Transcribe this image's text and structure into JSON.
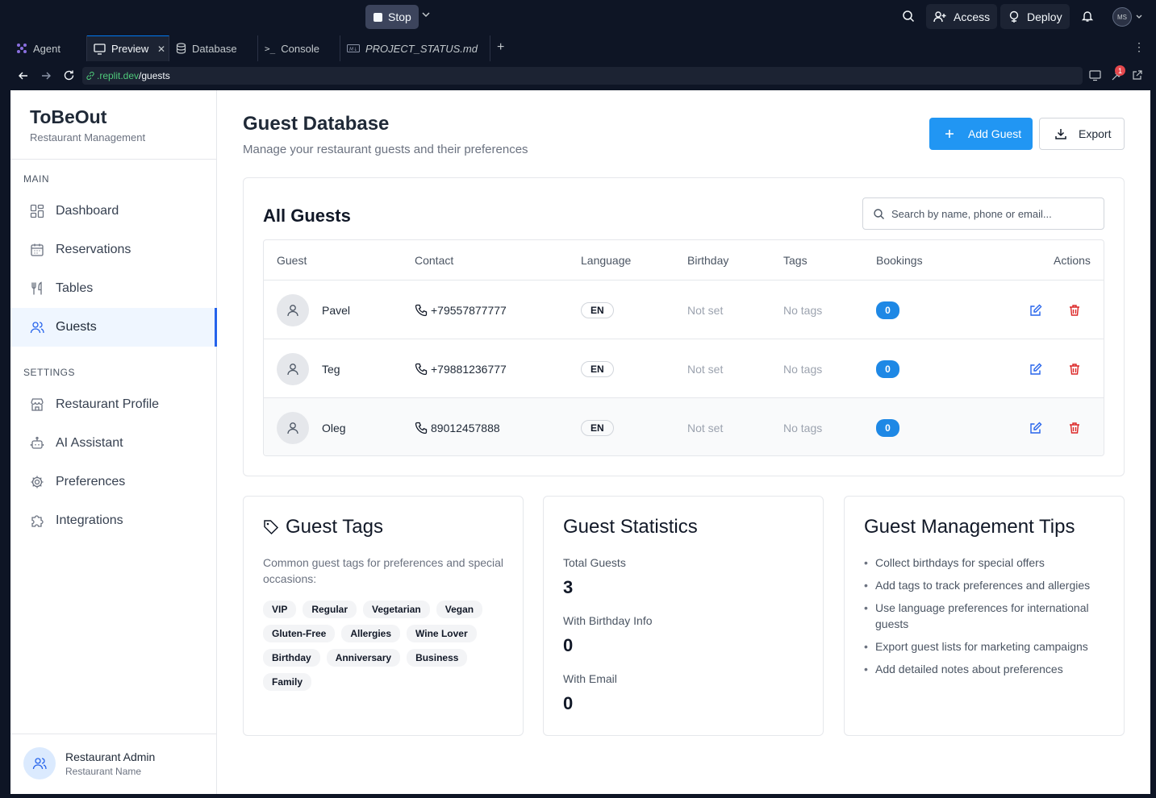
{
  "topbar": {
    "stop_label": "Stop",
    "access_label": "Access",
    "deploy_label": "Deploy",
    "avatar_initials": "MS"
  },
  "tabs": [
    {
      "label": "Agent"
    },
    {
      "label": "Preview"
    },
    {
      "label": "Database"
    },
    {
      "label": "Console"
    },
    {
      "label": "PROJECT_STATUS.md"
    }
  ],
  "address": {
    "host": ".replit.dev",
    "path": "/guests",
    "notification_count": "1"
  },
  "sidebar": {
    "brand": "ToBeOut",
    "brand_sub": "Restaurant Management",
    "main_heading": "MAIN",
    "main_items": [
      {
        "label": "Dashboard",
        "icon": "dashboard-icon"
      },
      {
        "label": "Reservations",
        "icon": "calendar-icon"
      },
      {
        "label": "Tables",
        "icon": "utensils-icon"
      },
      {
        "label": "Guests",
        "icon": "users-icon",
        "active": true
      }
    ],
    "settings_heading": "SETTINGS",
    "settings_items": [
      {
        "label": "Restaurant Profile",
        "icon": "store-icon"
      },
      {
        "label": "AI Assistant",
        "icon": "bot-icon"
      },
      {
        "label": "Preferences",
        "icon": "gear-icon"
      },
      {
        "label": "Integrations",
        "icon": "puzzle-icon"
      }
    ],
    "user_name": "Restaurant Admin",
    "user_sub": "Restaurant Name"
  },
  "page": {
    "title": "Guest Database",
    "subtitle": "Manage your restaurant guests and their preferences",
    "add_label": "Add Guest",
    "export_label": "Export"
  },
  "guests": {
    "title": "All Guests",
    "search_placeholder": "Search by name, phone or email...",
    "columns": [
      "Guest",
      "Contact",
      "Language",
      "Birthday",
      "Tags",
      "Bookings",
      "Actions"
    ],
    "rows": [
      {
        "name": "Pavel",
        "phone": "+79557877777",
        "language": "EN",
        "birthday": "Not set",
        "tags": "No tags",
        "bookings": "0"
      },
      {
        "name": "Teg",
        "phone": "+79881236777",
        "language": "EN",
        "birthday": "Not set",
        "tags": "No tags",
        "bookings": "0"
      },
      {
        "name": "Oleg",
        "phone": "89012457888",
        "language": "EN",
        "birthday": "Not set",
        "tags": "No tags",
        "bookings": "0"
      }
    ]
  },
  "guest_tags": {
    "title": "Guest Tags",
    "description": "Common guest tags for preferences and special occasions:",
    "tags": [
      "VIP",
      "Regular",
      "Vegetarian",
      "Vegan",
      "Gluten-Free",
      "Allergies",
      "Wine Lover",
      "Birthday",
      "Anniversary",
      "Business",
      "Family"
    ]
  },
  "stats": {
    "title": "Guest Statistics",
    "items": [
      {
        "label": "Total Guests",
        "value": "3"
      },
      {
        "label": "With Birthday Info",
        "value": "0"
      },
      {
        "label": "With Email",
        "value": "0"
      }
    ]
  },
  "tips": {
    "title": "Guest Management Tips",
    "items": [
      "Collect birthdays for special offers",
      "Add tags to track preferences and allergies",
      "Use language preferences for international guests",
      "Export guest lists for marketing campaigns",
      "Add detailed notes about preferences"
    ]
  },
  "colors": {
    "primary": "#2196f3",
    "active_nav_bg": "#eff6ff",
    "danger": "#dc2626",
    "ide_bg": "#0e1525"
  }
}
